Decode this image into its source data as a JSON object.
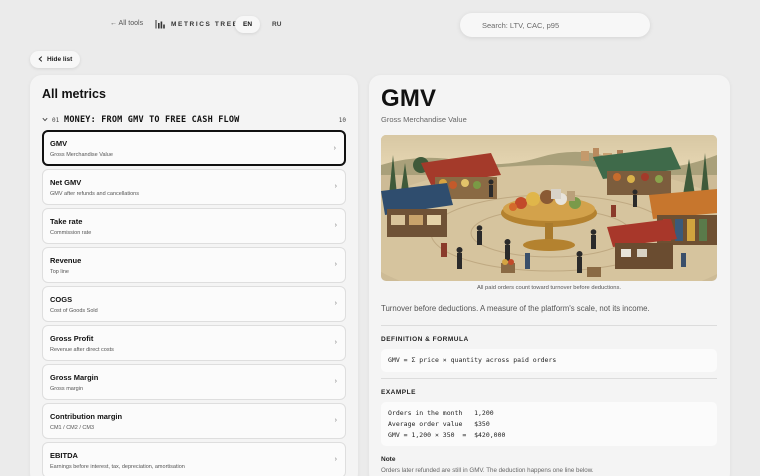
{
  "header": {
    "back_label": "← All tools",
    "brand_label": "METRICS TREE",
    "brand_icon": "bar-chart-icon",
    "languages": [
      {
        "code": "EN",
        "active": true
      },
      {
        "code": "RU",
        "active": false
      }
    ],
    "search_placeholder": "Search: LTV, CAC, p95"
  },
  "sidebar_toggle": {
    "label": "Hide list",
    "icon": "chevron-left-icon"
  },
  "left": {
    "title": "All metrics",
    "group": {
      "number": "01",
      "title": "MONEY: FROM GMV TO FREE CASH FLOW",
      "count": "10",
      "expanded": true
    },
    "metrics": [
      {
        "name": "GMV",
        "sub": "Gross Merchandise Value",
        "selected": true
      },
      {
        "name": "Net GMV",
        "sub": "GMV after refunds and cancellations",
        "selected": false
      },
      {
        "name": "Take rate",
        "sub": "Commission rate",
        "selected": false
      },
      {
        "name": "Revenue",
        "sub": "Top line",
        "selected": false
      },
      {
        "name": "COGS",
        "sub": "Cost of Goods Sold",
        "selected": false
      },
      {
        "name": "Gross Profit",
        "sub": "Revenue after direct costs",
        "selected": false
      },
      {
        "name": "Gross Margin",
        "sub": "Gross margin",
        "selected": false
      },
      {
        "name": "Contribution margin",
        "sub": "CM1 / CM2 / CM3",
        "selected": false
      },
      {
        "name": "EBITDA",
        "sub": "Earnings before interest, tax, depreciation, amortisation",
        "selected": false
      }
    ]
  },
  "detail": {
    "title": "GMV",
    "subtitle": "Gross Merchandise Value",
    "image_caption": "All paid orders count toward turnover before deductions.",
    "lead": "Turnover before deductions. A measure of the platform's scale, not its income.",
    "definition_label": "DEFINITION & FORMULA",
    "formula": "GMV = Σ price × quantity across paid orders",
    "example_label": "EXAMPLE",
    "example_lines": [
      "Orders in the month   1,200",
      "Average order value   $350",
      "GMV = 1,200 × 350  =  $420,000"
    ],
    "note_title": "Note",
    "note_text": "Orders later refunded are still in GMV. The deduction happens one line below."
  },
  "colors": {
    "page_bg": "#ebebeb",
    "panel_bg": "#f4f4f4",
    "card_bg": "#fbfbfb",
    "selected_border": "#111111"
  }
}
